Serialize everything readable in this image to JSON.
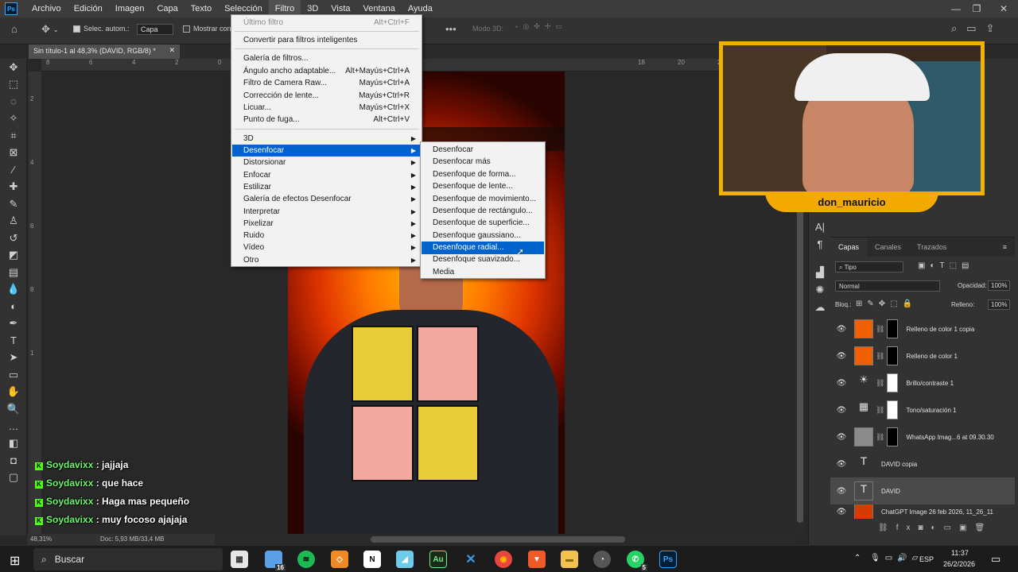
{
  "menubar": {
    "logo": "Ps",
    "items": [
      "Archivo",
      "Edición",
      "Imagen",
      "Capa",
      "Texto",
      "Selección",
      "Filtro",
      "3D",
      "Vista",
      "Ventana",
      "Ayuda"
    ]
  },
  "optionsbar": {
    "autoselect_label": "Selec. autom.:",
    "autoselect_value": "Capa",
    "show_transform": "Mostrar con",
    "mode3d": "Modo 3D:"
  },
  "document": {
    "tab_title": "Sin título-1 al 48,3% (DAVID, RGB/8) *",
    "zoom": "48,31%",
    "doc_info": "Doc: 5,93 MB/33,4 MB"
  },
  "filter_menu": {
    "items": [
      {
        "label": "Último filtro",
        "shortcut": "Alt+Ctrl+F"
      },
      {
        "label": "Convertir para filtros inteligentes",
        "shortcut": ""
      },
      {
        "label": "Galería de filtros...",
        "shortcut": ""
      },
      {
        "label": "Ángulo ancho adaptable...",
        "shortcut": "Alt+Mayús+Ctrl+A"
      },
      {
        "label": "Filtro de Camera Raw...",
        "shortcut": "Mayús+Ctrl+A"
      },
      {
        "label": "Corrección de lente...",
        "shortcut": "Mayús+Ctrl+R"
      },
      {
        "label": "Licuar...",
        "shortcut": "Mayús+Ctrl+X"
      },
      {
        "label": "Punto de fuga...",
        "shortcut": "Alt+Ctrl+V"
      },
      {
        "label": "3D",
        "shortcut": ""
      },
      {
        "label": "Desenfocar",
        "shortcut": ""
      },
      {
        "label": "Distorsionar",
        "shortcut": ""
      },
      {
        "label": "Enfocar",
        "shortcut": ""
      },
      {
        "label": "Estilizar",
        "shortcut": ""
      },
      {
        "label": "Galería de efectos Desenfocar",
        "shortcut": ""
      },
      {
        "label": "Interpretar",
        "shortcut": ""
      },
      {
        "label": "Pixelizar",
        "shortcut": ""
      },
      {
        "label": "Ruido",
        "shortcut": ""
      },
      {
        "label": "Vídeo",
        "shortcut": ""
      },
      {
        "label": "Otro",
        "shortcut": ""
      }
    ]
  },
  "blur_menu": {
    "items": [
      "Desenfocar",
      "Desenfocar más",
      "Desenfoque de forma...",
      "Desenfoque de lente...",
      "Desenfoque de movimiento...",
      "Desenfoque de rectángulo...",
      "Desenfoque de superficie...",
      "Desenfoque gaussiano...",
      "Desenfoque radial...",
      "Desenfoque suavizado...",
      "Media"
    ]
  },
  "webcam": {
    "name": "don_mauricio"
  },
  "chat": [
    {
      "user": "Soydavixx",
      "text": " : jajjaja"
    },
    {
      "user": "Soydavixx",
      "text": " : que hace"
    },
    {
      "user": "Soydavixx",
      "text": " : Haga mas pequeño"
    },
    {
      "user": "Soydavixx",
      "text": " : muy focoso ajajaja"
    }
  ],
  "layers_panel": {
    "tabs": [
      "Capas",
      "Canales",
      "Trazados"
    ],
    "filter_kind": "Tipo",
    "blend_mode": "Normal",
    "opacity_label": "Opacidad:",
    "opacity_value": "100%",
    "lock_label": "Bloq.:",
    "fill_label": "Relleno:",
    "fill_value": "100%",
    "layers": [
      {
        "name": "Relleno de color 1 copia"
      },
      {
        "name": "Relleno de color 1"
      },
      {
        "name": "Brillo/contraste 1"
      },
      {
        "name": "Tono/saturación 1"
      },
      {
        "name": "WhatsApp Imag...6 at 09.30.30"
      },
      {
        "name": "DAVID copia"
      },
      {
        "name": "DAVID"
      },
      {
        "name": "ChatGPT Image 26 feb 2026, 11_26_11"
      }
    ]
  },
  "taskbar": {
    "search_placeholder": "Buscar",
    "badge_explorer": "16",
    "badge_whatsapp": "5",
    "lang": "ESP",
    "time": "11:37",
    "date": "26/2/2026"
  },
  "colors": {
    "accent_highlight": "#0063cc",
    "cam_frame": "#f2b000",
    "chat_user": "#6cf96c"
  }
}
